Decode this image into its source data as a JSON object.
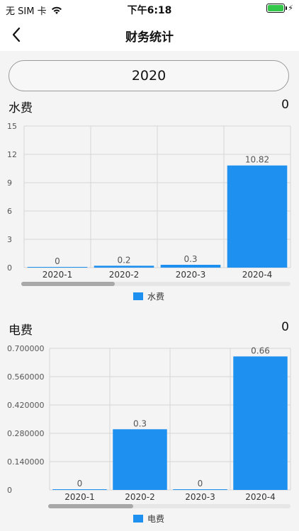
{
  "status_bar": {
    "carrier": "无 SIM 卡",
    "time": "下午6:18"
  },
  "nav": {
    "title": "财务统计"
  },
  "year_selector": {
    "value": "2020"
  },
  "water": {
    "title": "水费",
    "total": "0",
    "legend": "水费"
  },
  "electric": {
    "title": "电费",
    "total": "0",
    "legend": "电费"
  },
  "colors": {
    "bar": "#1e90f0",
    "grid": "#d6d6d6",
    "scroll_thumb": "#a8a8a8",
    "scroll_track": "#e6e6e6"
  },
  "chart_data": [
    {
      "type": "bar",
      "categories": [
        "2020-1",
        "2020-2",
        "2020-3",
        "2020-4"
      ],
      "series": [
        {
          "name": "水费",
          "values": [
            0,
            0.2,
            0.3,
            10.82
          ]
        }
      ],
      "data_labels": [
        "0",
        "0.2",
        "0.3",
        "10.82"
      ],
      "y_ticks": [
        "0",
        "3",
        "6",
        "9",
        "12",
        "15"
      ],
      "ylim": [
        0,
        15
      ],
      "grid": true,
      "legend_position": "bottom-center"
    },
    {
      "type": "bar",
      "categories": [
        "2020-1",
        "2020-2",
        "2020-3",
        "2020-4"
      ],
      "series": [
        {
          "name": "电费",
          "values": [
            0,
            0.3,
            0,
            0.66
          ]
        }
      ],
      "data_labels": [
        "0",
        "0.3",
        "0",
        "0.66"
      ],
      "y_ticks": [
        "0",
        "0.140000",
        "0.280000",
        "0.420000",
        "0.560000",
        "0.700000"
      ],
      "ylim": [
        0,
        0.7
      ],
      "grid": true,
      "legend_position": "bottom-center"
    }
  ]
}
